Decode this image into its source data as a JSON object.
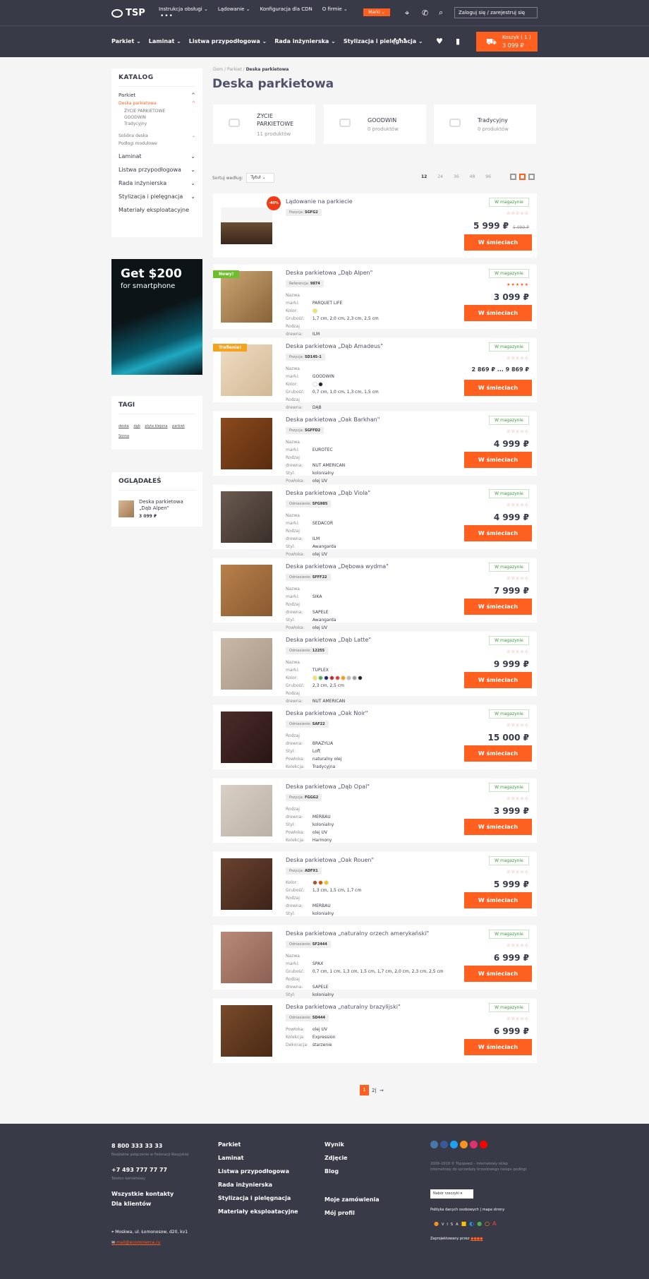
{
  "header": {
    "logo_text": "TSP",
    "top_links": [
      "Instrukcja obsługi ⌄",
      "Lądowanie ⌄",
      "Konfiguracja dla CDN",
      "O firmie ⌄"
    ],
    "more": "•••",
    "brands_label": "Marki ⌄",
    "login_text": "Zaloguj się  /  zarejestruj się",
    "main_nav": [
      "Parkiet ⌄",
      "Laminat ⌄",
      "Listwa przypodłogowa ⌄",
      "Rada inżynierska ⌄",
      "Stylizacja i pielęgnacja ⌄"
    ],
    "cart_label": "Koszyk ( 1 )",
    "cart_price": "3 099 ₽"
  },
  "sidebar": {
    "catalog_title": "KATALOG",
    "parkiet": "Parkiet",
    "active": "Deska parkietowa",
    "sub": [
      "ŻYCIE PARKIETOWE",
      "GOODWIN",
      "Tradycyjny"
    ],
    "solid": "Solidna deska",
    "modular": "Podłogi modułowe",
    "big_items": [
      "Laminat",
      "Listwa przypodłogowa",
      "Rada inżynierska",
      "Stylizacja i pielęgnacja",
      "Materiały eksploatacyjne"
    ],
    "banner_line1": "Get $200",
    "banner_line2": "for smartphone",
    "tags_title": "TAGI",
    "tags": [
      "deska",
      "dąb",
      "płyta klejona",
      "parkiet",
      "Sosna"
    ],
    "viewed_title": "OGLĄDAŁEŚ",
    "viewed_name": "Deska parkietowa „Dąb Alpen\"",
    "viewed_price": "3 099 ₽"
  },
  "breadcrumb": [
    "Dom",
    "/",
    "Parkiet",
    "/",
    "Deska parkietowa"
  ],
  "page_title": "Deska parkietowa",
  "subcats": [
    {
      "name": "ŻYCIE PARKIETOWE",
      "count": "11 produktów"
    },
    {
      "name": "GOODWIN",
      "count": "0 produktów"
    },
    {
      "name": "Tradycyjny",
      "count": "0 produktów"
    }
  ],
  "sort": {
    "label": "Sortuj według:",
    "value": "Tytuł ⌄",
    "sizes": [
      "12",
      "24",
      "36",
      "48",
      "96"
    ]
  },
  "products": [
    {
      "name": "Lądowanie na parkiecie",
      "ref_label": "Pozycja:",
      "ref": "SGFG2",
      "stock": "W magazynie",
      "stars": "☆☆☆☆☆",
      "price": "5 999 ₽",
      "old": "5 999 ₽",
      "badge": "-40%",
      "buy": "W śmieciach",
      "attrs": []
    },
    {
      "name": "Deska parkietowa „Dąb Alpen\"",
      "ref_label": "Referencja:",
      "ref": "9874",
      "stock": "W magazynie",
      "stars": "★★★★★",
      "price": "3 099 ₽",
      "badge": "Nowy!",
      "buy": "W śmieciach",
      "attrs": [
        {
          "k": "Nazwa marki:",
          "v": "PARQUET LIFE"
        },
        {
          "k": "Kolor:",
          "v": ""
        },
        {
          "k": "Grubość:",
          "v": "1,7 cm, 2,0 cm, 2,3 cm, 2,5 cm"
        },
        {
          "k": "Rodzaj drewna:",
          "v": "ILM"
        }
      ]
    },
    {
      "name": "Deska parkietowa „Dąb Amadeus\"",
      "ref_label": "Pozycja:",
      "ref": "SD145-1",
      "stock": "W magazynie",
      "stars": "☆☆☆☆☆",
      "price": "2 869 ₽ ... 9 869 ₽",
      "badge": "Trafienie!",
      "buy": "W śmieciach",
      "attrs": [
        {
          "k": "Nazwa marki:",
          "v": "GOODWIN"
        },
        {
          "k": "Kolor:",
          "v": ""
        },
        {
          "k": "Grubość:",
          "v": "0,7 cm, 1,0 cm, 1,3 cm, 1,5 cm"
        },
        {
          "k": "Rodzaj drewna:",
          "v": "DĄB"
        }
      ]
    },
    {
      "name": "Deska parkietowa „Oak Barkhan\"",
      "ref_label": "Pozycja:",
      "ref": "SGFFD2",
      "stock": "W magazynie",
      "stars": "☆☆☆☆☆",
      "price": "4 999 ₽",
      "buy": "W śmieciach",
      "attrs": [
        {
          "k": "Nazwa marki:",
          "v": "EUROTEC"
        },
        {
          "k": "Rodzaj drewna:",
          "v": "NUT AMERICAN"
        },
        {
          "k": "Styl:",
          "v": "kolonialny"
        },
        {
          "k": "Powłoka:",
          "v": "olej UV"
        }
      ]
    },
    {
      "name": "Deska parkietowa „Dąb Viola\"",
      "ref_label": "Odniesienie:",
      "ref": "SFG985",
      "stock": "W magazynie",
      "stars": "☆☆☆☆☆",
      "price": "4 999 ₽",
      "buy": "W śmieciach",
      "attrs": [
        {
          "k": "Nazwa marki:",
          "v": "SEDACOR"
        },
        {
          "k": "Rodzaj drewna:",
          "v": "ILM"
        },
        {
          "k": "Styl:",
          "v": "Awangarda"
        },
        {
          "k": "Powłoka:",
          "v": "olej UV"
        }
      ]
    },
    {
      "name": "Deska parkietowa „Dębowa wydma\"",
      "ref_label": "Odniesienie:",
      "ref": "SFFF22",
      "stock": "W magazynie",
      "stars": "☆☆☆☆☆",
      "price": "7 999 ₽",
      "buy": "W śmieciach",
      "attrs": [
        {
          "k": "Nazwa marki:",
          "v": "SIKA"
        },
        {
          "k": "Rodzaj drewna:",
          "v": "SAPELE"
        },
        {
          "k": "Styl:",
          "v": "Awangarda"
        },
        {
          "k": "Powłoka:",
          "v": "olej UV"
        }
      ]
    },
    {
      "name": "Deska parkietowa „Dąb Latte\"",
      "ref_label": "Odniesienie:",
      "ref": "12255",
      "stock": "W magazynie",
      "stars": "☆☆☆☆☆",
      "price": "9 999 ₽",
      "buy": "W śmieciach",
      "attrs": [
        {
          "k": "Nazwa marki:",
          "v": "TUPLEX"
        },
        {
          "k": "Kolor:",
          "v": ""
        },
        {
          "k": "Grubość:",
          "v": "2,3 cm, 2,5 cm"
        },
        {
          "k": "Rodzaj drewna:",
          "v": "NUT AMERICAN"
        }
      ]
    },
    {
      "name": "Deska parkietowa „Oak Noir\"",
      "ref_label": "Odniesienie:",
      "ref": "SAF22",
      "stock": "W magazynie",
      "stars": "☆☆☆☆☆",
      "price": "15 000 ₽",
      "buy": "W śmieciach",
      "attrs": [
        {
          "k": "Rodzaj drewna:",
          "v": "BRAZYLIA"
        },
        {
          "k": "Styl:",
          "v": "Loft"
        },
        {
          "k": "Powłoka:",
          "v": "naturalny olej"
        },
        {
          "k": "Kolekcja:",
          "v": "Tradycyjna"
        }
      ]
    },
    {
      "name": "Deska parkietowa „Dąb Opal\"",
      "ref_label": "Pozycja:",
      "ref": "FGGG2",
      "stock": "W magazynie",
      "stars": "☆☆☆☆☆",
      "price": "3 999 ₽",
      "buy": "W śmieciach",
      "attrs": [
        {
          "k": "Rodzaj drewna:",
          "v": "MERBAU"
        },
        {
          "k": "Styl:",
          "v": "kolonialny"
        },
        {
          "k": "Powłoka:",
          "v": "olej UV"
        },
        {
          "k": "Kolekcja:",
          "v": "Harmony"
        }
      ]
    },
    {
      "name": "Deska parkietowa „Oak Rouen\"",
      "ref_label": "Pozycja:",
      "ref": "ADFX1",
      "stock": "W magazynie",
      "stars": "☆☆☆☆☆",
      "price": "5 999 ₽",
      "buy": "W śmieciach",
      "attrs": [
        {
          "k": "Kolor:",
          "v": ""
        },
        {
          "k": "Grubość:",
          "v": "1,3 cm, 1,5 cm, 1,7 cm"
        },
        {
          "k": "Rodzaj drewna:",
          "v": "MERBAU"
        },
        {
          "k": "Styl:",
          "v": "kolonialny"
        }
      ]
    },
    {
      "name": "Deska parkietowa „naturalny orzech amerykański\"",
      "ref_label": "Odniesienie:",
      "ref": "SF2444",
      "stock": "W magazynie",
      "stars": "☆☆☆☆☆",
      "price": "6 999 ₽",
      "buy": "W śmieciach",
      "attrs": [
        {
          "k": "Nazwa marki:",
          "v": "SPAX"
        },
        {
          "k": "Grubość:",
          "v": "0,7 cm, 1 cm, 1,3 cm, 1,5 cm, 1,7 cm, 2,0 cm, 2,3 cm, 2,5 cm"
        },
        {
          "k": "Rodzaj drewna:",
          "v": "SAPELE"
        },
        {
          "k": "Styl:",
          "v": "kolonialny"
        }
      ]
    },
    {
      "name": "Deska parkietowa „naturalny brazylijski\"",
      "ref_label": "Odniesienie:",
      "ref": "SD444",
      "stock": "W magazynie",
      "stars": "☆☆☆☆☆",
      "price": "6 999 ₽",
      "buy": "W śmieciach",
      "attrs": [
        {
          "k": "Powłoka:",
          "v": "olej UV"
        },
        {
          "k": "Kolekcja:",
          "v": "Expression"
        },
        {
          "k": "Dekoracja:",
          "v": "starzenie"
        }
      ]
    }
  ],
  "pagination": {
    "current": "1",
    "next": "2|",
    "arrow": "→"
  },
  "footer": {
    "phone1": "8 800 333 33 33",
    "phone1_note": "Bezpłatne połączenie w Federacji Rosyjskiej",
    "phone2": "+7 493 777 77 77",
    "phone2_note": "Telefon komórkowy",
    "contacts": "Wszystkie kontakty",
    "clients": "Dla klientów",
    "address": "Moskwa, ul. Łomonosow, d20, kv1",
    "email": "mail@ecommerce.ru",
    "col2": [
      "Parkiet",
      "Laminat",
      "Listwa przypodłogowa",
      "Rada inżynierska",
      "Stylizacja i pielęgnacja",
      "Materiały eksploatacyjne"
    ],
    "col3": [
      "Wynik",
      "Zdjęcie",
      "Blog"
    ],
    "col3b": [
      "Moje zamówienia",
      "Mój profil"
    ],
    "copyright": "2009–2019 © Topspeed – internetowy sklep internetowy do sprzedaży krzesłowego nalepu podłogi",
    "select": "Nabór rzeczyki ▾",
    "policy": "Polityka danych osobowych  |  mapa strony",
    "designed": "Zaprojektowany przez"
  }
}
